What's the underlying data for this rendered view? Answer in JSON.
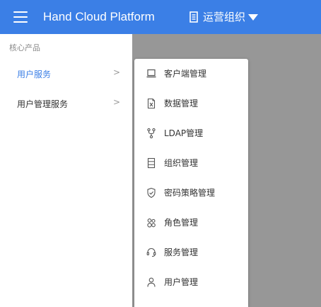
{
  "header": {
    "app_title": "Hand Cloud Platform",
    "org_label": "运营组织",
    "bar_color": "#3b7fe6",
    "icons": [
      "menu-icon",
      "building-icon",
      "caret-down-icon"
    ]
  },
  "sidebar": {
    "section_label": "核心产品",
    "items": [
      {
        "label": "用户服务",
        "active": true
      },
      {
        "label": "用户管理服务",
        "active": false
      }
    ],
    "chevron": ">"
  },
  "submenu": {
    "items": [
      {
        "label": "客户端管理",
        "icon": "laptop-icon"
      },
      {
        "label": "数据管理",
        "icon": "excel-file-icon"
      },
      {
        "label": "LDAP管理",
        "icon": "fork-icon"
      },
      {
        "label": "组织管理",
        "icon": "org-list-icon"
      },
      {
        "label": "密码策略管理",
        "icon": "shield-check-icon"
      },
      {
        "label": "角色管理",
        "icon": "users-icon"
      },
      {
        "label": "服务管理",
        "icon": "headset-icon"
      },
      {
        "label": "用户管理",
        "icon": "user-icon"
      }
    ]
  }
}
